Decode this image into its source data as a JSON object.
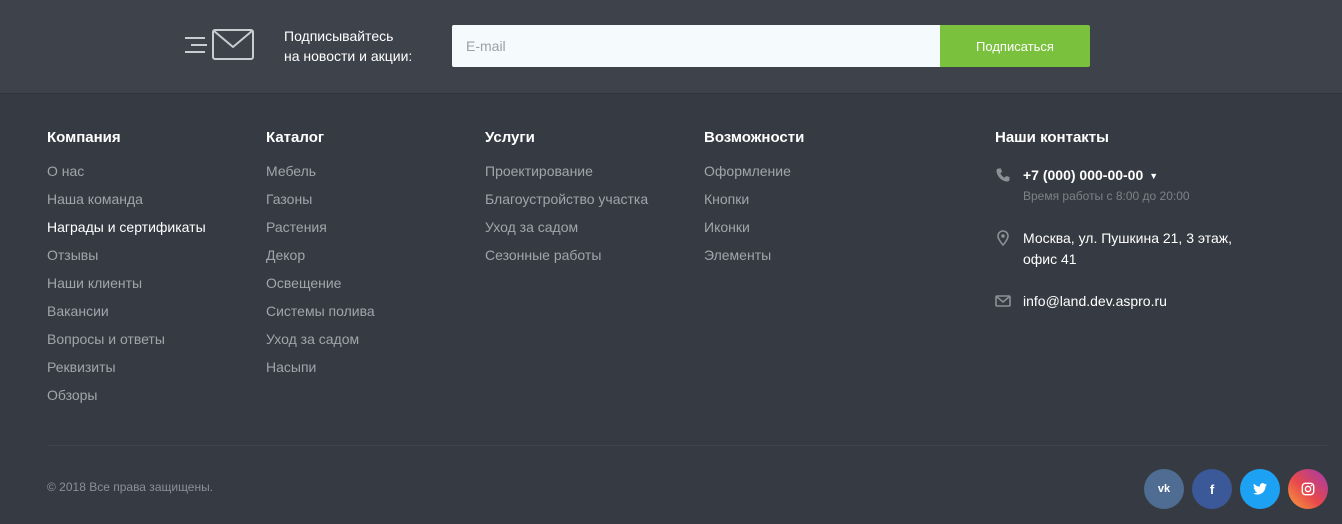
{
  "subscribe": {
    "text_line1": "Подписывайтесь",
    "text_line2": "на новости и акции:",
    "email_placeholder": "E-mail",
    "button_label": "Подписаться"
  },
  "columns": [
    {
      "title": "Компания",
      "items": [
        "О нас",
        "Наша команда",
        "Награды и сертификаты",
        "Отзывы",
        "Наши клиенты",
        "Вакансии",
        "Вопросы и ответы",
        "Реквизиты",
        "Обзоры"
      ]
    },
    {
      "title": "Каталог",
      "items": [
        "Мебель",
        "Газоны",
        "Растения",
        "Декор",
        "Освещение",
        "Системы полива",
        "Уход за садом",
        "Насыпи"
      ]
    },
    {
      "title": "Услуги",
      "items": [
        "Проектирование",
        "Благоустройство участка",
        "Уход за садом",
        "Сезонные работы"
      ]
    },
    {
      "title": "Возможности",
      "items": [
        "Оформление",
        "Кнопки",
        "Иконки",
        "Элементы"
      ]
    }
  ],
  "contacts": {
    "title": "Наши контакты",
    "phone": "+7 (000) 000-00-00",
    "hours": "Время работы с 8:00 до 20:00",
    "address_line1": "Москва, ул. Пушкина 21, 3 этаж,",
    "address_line2": "офис 41",
    "email": "info@land.dev.aspro.ru"
  },
  "footer": {
    "copyright": "© 2018 Все права защищены.",
    "social": [
      {
        "name": "vk",
        "glyph": "vk"
      },
      {
        "name": "facebook",
        "glyph": "f"
      },
      {
        "name": "twitter",
        "glyph": "twitter-bird"
      },
      {
        "name": "instagram",
        "glyph": "instagram-camera"
      }
    ]
  },
  "colors": {
    "background": "#363a42",
    "subscribe_bar": "#3e424b",
    "accent_green": "#7ac13e",
    "heading": "#ffffff",
    "link": "#a1a5ab"
  }
}
